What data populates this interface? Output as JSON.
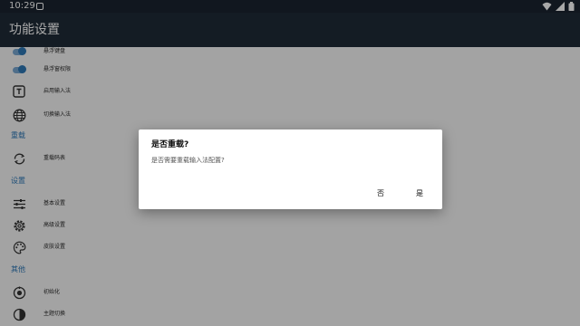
{
  "statusbar": {
    "time": "10:29"
  },
  "appbar": {
    "title": "功能设置"
  },
  "colors": {
    "accent": "#2e78b7",
    "appbar": "#1f2b37",
    "statusbar": "#1a2430"
  },
  "settings": {
    "items": [
      {
        "label": "悬浮键盘",
        "icon": "toggle-icon"
      },
      {
        "label": "悬浮窗权限",
        "icon": "toggle-icon"
      },
      {
        "label": "启用输入法",
        "icon": "text-icon"
      },
      {
        "label": "切换输入法",
        "icon": "globe-icon"
      }
    ],
    "section_reload": "重载",
    "reload_item": {
      "label": "重载码表",
      "icon": "sync-icon"
    },
    "section_settings": "设置",
    "settings_items": [
      {
        "label": "基本设置",
        "icon": "sliders-icon"
      },
      {
        "label": "高级设置",
        "icon": "gear-icon"
      },
      {
        "label": "皮肤设置",
        "icon": "palette-icon"
      }
    ],
    "section_other": "其他",
    "other_items": [
      {
        "label": "初始化",
        "icon": "reset-icon"
      },
      {
        "label": "主题切换",
        "icon": "contrast-icon"
      }
    ]
  },
  "dialog": {
    "title": "是否重载?",
    "message": "是否需要重载输入法配置?",
    "no_label": "否",
    "yes_label": "是"
  }
}
